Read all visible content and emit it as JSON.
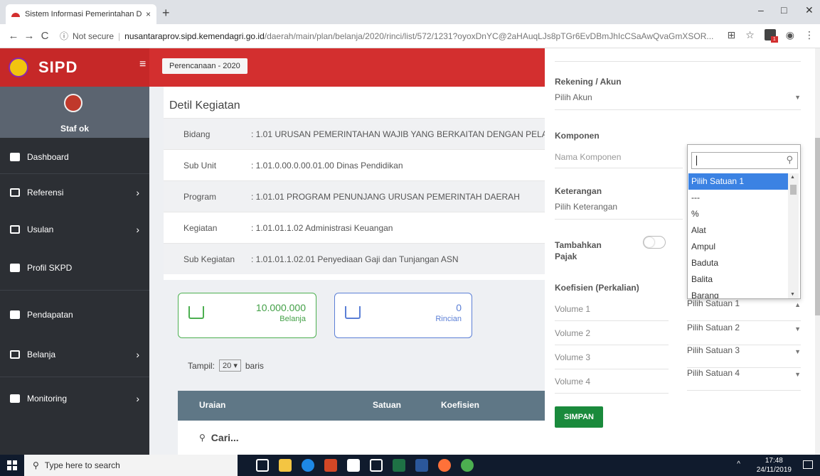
{
  "browser": {
    "tab_title": "Sistem Informasi Pemerintahan D",
    "tab_close": "×",
    "new_tab": "+",
    "back": "←",
    "forward": "→",
    "reload": "C",
    "not_secure": "Not secure",
    "url_host": "nusantaraprov.sipd.kemendagri.go.id",
    "url_path": "/daerah/main/plan/belanja/2020/rinci/list/572/1231?oyoxDnYC@2aHAuqLJs8pTGr6EvDBmJhIcCSaAwQvaGmXSOR...",
    "minimize": "–",
    "maximize": "□",
    "close": "✕"
  },
  "sidebar": {
    "brand": "SIPD",
    "user_name": "Staf ok",
    "items": [
      {
        "label": "Dashboard",
        "icon": "dashboard-icon",
        "chevron": ""
      },
      {
        "label": "Referensi",
        "icon": "copy-icon",
        "chevron": "›"
      },
      {
        "label": "Usulan",
        "icon": "chat-icon",
        "chevron": "›"
      },
      {
        "label": "Profil SKPD",
        "icon": "id-card-icon",
        "chevron": ""
      },
      {
        "label": "Pendapatan",
        "icon": "wallet-icon",
        "chevron": ""
      },
      {
        "label": "Belanja",
        "icon": "cart-icon",
        "chevron": "›"
      },
      {
        "label": "Monitoring",
        "icon": "building-icon",
        "chevron": "›"
      }
    ]
  },
  "header": {
    "hamburger": "≡",
    "year_label": "Perencanaan - 2020"
  },
  "detail": {
    "title": "Detil Kegiatan",
    "rows": [
      {
        "label": "Bidang",
        "value": ":  1.01 URUSAN PEMERINTAHAN WAJIB YANG BERKAITAN DENGAN PELA"
      },
      {
        "label": "Sub Unit",
        "value": ":  1.01.0.00.0.00.01.00 Dinas Pendidikan"
      },
      {
        "label": "Program",
        "value": ":  1.01.01  PROGRAM PENUNJANG URUSAN PEMERINTAH DAERAH"
      },
      {
        "label": "Kegiatan",
        "value": ":  1.01.01.1.02 Administrasi Keuangan"
      },
      {
        "label": "Sub Kegiatan",
        "value": ":  1.01.01.1.02.01  Penyediaan Gaji dan Tunjangan ASN"
      }
    ]
  },
  "stats": {
    "belanja_value": "10.000.000",
    "belanja_label": "Belanja",
    "rincian_value": "0",
    "rincian_label": "Rincian"
  },
  "table": {
    "tampil_label": "Tampil:",
    "page_size": "20",
    "baris_label": "baris",
    "columns": [
      "Uraian",
      "Satuan",
      "Koefisien"
    ],
    "search_placeholder": "Cari..."
  },
  "form": {
    "rekening_label": "Rekening / Akun",
    "rekening_value": "Pilih Akun",
    "komponen_label": "Komponen",
    "komponen_placeholder": "Nama Komponen",
    "keterangan_label": "Keterangan",
    "keterangan_value": "Pilih Keterangan",
    "pajak_label_1": "Tambahkan",
    "pajak_label_2": "Pajak",
    "koefisien_label": "Koefisien (Perkalian)",
    "volumes": [
      "Volume 1",
      "Volume 2",
      "Volume 3",
      "Volume 4"
    ],
    "satuans": [
      "Pilih Satuan 1",
      "Pilih Satuan 2",
      "Pilih Satuan 3",
      "Pilih Satuan 4"
    ],
    "save_label": "SIMPAN"
  },
  "dropdown": {
    "search_value": "",
    "options": [
      "Pilih Satuan 1",
      "---",
      "%",
      "Alat",
      "Ampul",
      "Baduta",
      "Balita",
      "Barang"
    ],
    "selected_index": 0
  },
  "taskbar": {
    "search_placeholder": "Type here to search",
    "time": "17:48",
    "date": "24/11/2019"
  },
  "colors": {
    "brand_red": "#d32f2f",
    "sidebar_dark": "#2c2f34",
    "accent_green": "#43a047",
    "accent_blue": "#5b7fd6",
    "table_header": "#5f7786",
    "select_blue": "#3b82e3"
  }
}
